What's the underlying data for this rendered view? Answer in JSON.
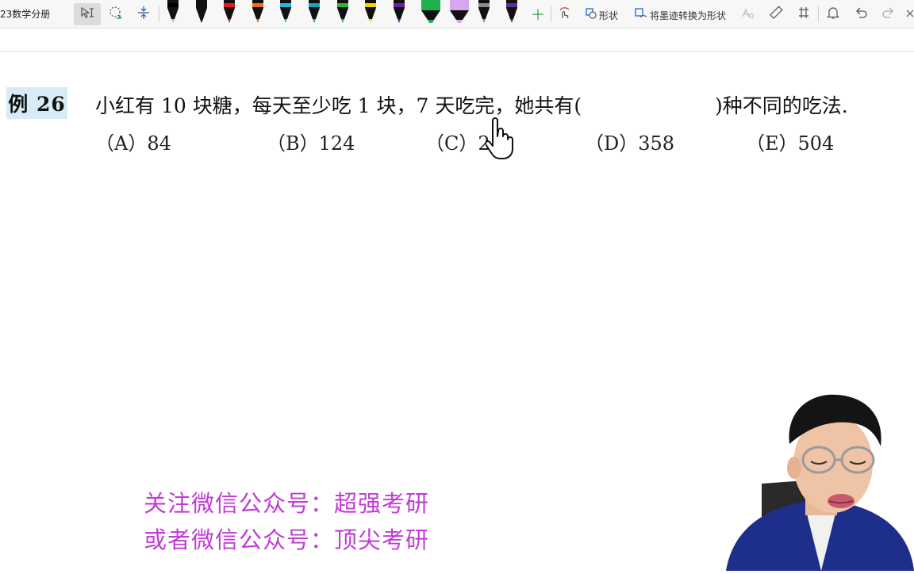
{
  "toolbar": {
    "doc_title": "23数学分册",
    "shape_label": "形状",
    "ink_to_shape_label": "将墨迹转换为形状",
    "icons": [
      "select-icon",
      "lasso-icon",
      "insert-space-icon",
      "add-pen-icon",
      "ink-to-shape-icon",
      "ruler-icon",
      "math-icon",
      "bell-icon",
      "undo-icon",
      "redo-icon",
      "close-icon"
    ],
    "pens": [
      {
        "name": "pen-black-lavender",
        "color": "#000000",
        "accent": "#c9a6e6"
      },
      {
        "name": "pen-black",
        "color": "#111111",
        "accent": "#111111"
      },
      {
        "name": "pen-red",
        "color": "#e11b22",
        "accent": "#e11b22"
      },
      {
        "name": "pen-orange",
        "color": "#f26a1b",
        "accent": "#f26a1b"
      },
      {
        "name": "pen-cyan",
        "color": "#2ab4e6",
        "accent": "#2ab4e6"
      },
      {
        "name": "pen-teal",
        "color": "#18a5b8",
        "accent": "#18a5b8"
      },
      {
        "name": "pen-green",
        "color": "#2db52d",
        "accent": "#2db52d"
      },
      {
        "name": "pen-yellow",
        "color": "#f5d300",
        "accent": "#f5d300"
      },
      {
        "name": "pen-purple",
        "color": "#6a1fa8",
        "accent": "#6a1fa8"
      },
      {
        "name": "highlighter-green",
        "color": "#1fb14b",
        "accent": "#1fb14b"
      },
      {
        "name": "highlighter-lavender",
        "color": "#d6a6ef",
        "accent": "#d6a6ef"
      },
      {
        "name": "pen-gray",
        "color": "#8a8a8a",
        "accent": "#8a8a8a"
      },
      {
        "name": "pen-violet",
        "color": "#5a2ca0",
        "accent": "#5a2ca0"
      }
    ]
  },
  "problem": {
    "badge": "例 26",
    "text": "小红有 10 块糖，每天至少吃 1 块，7 天吃完，她共有(",
    "text_after": ")种不同的吃法.",
    "choices": [
      {
        "label": "（A）84"
      },
      {
        "label": "（B）124"
      },
      {
        "label": "（C）2"
      },
      {
        "label": "（D）358"
      },
      {
        "label": "（E）504"
      }
    ]
  },
  "promo": {
    "line1": "关注微信公众号：超强考研",
    "line2": "或者微信公众号：顶尖考研",
    "color": "#c23bd6"
  },
  "colors": {
    "badge_bg": "#d7ecf6"
  }
}
